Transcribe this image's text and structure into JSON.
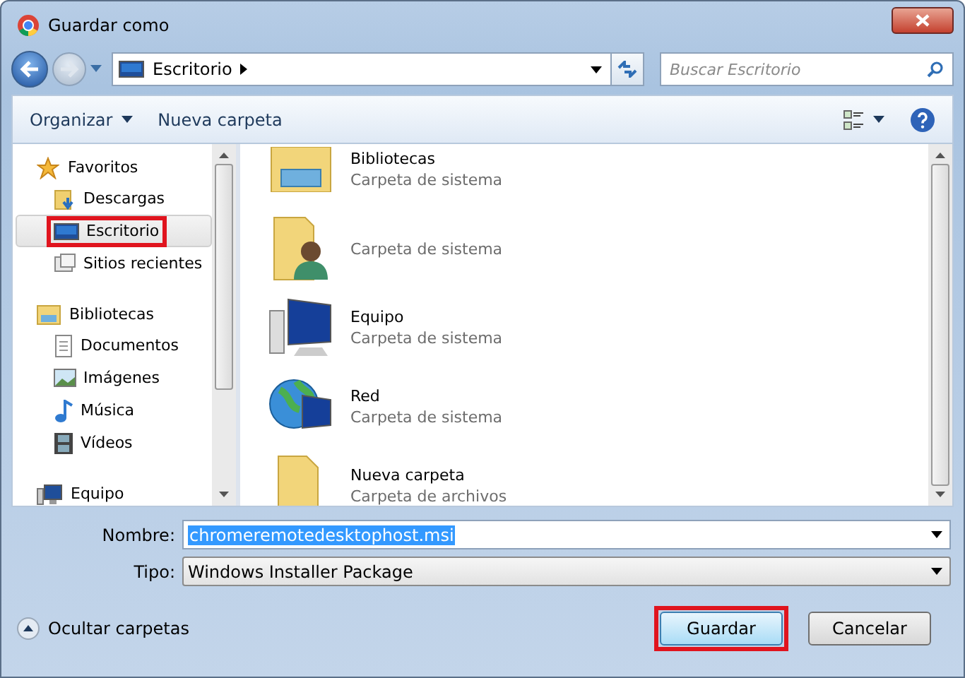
{
  "window": {
    "title": "Guardar como"
  },
  "address": {
    "location": "Escritorio",
    "search_placeholder": "Buscar Escritorio"
  },
  "toolbar": {
    "organize": "Organizar",
    "new_folder": "Nueva carpeta"
  },
  "sidebar": {
    "groups": [
      {
        "label": "Favoritos",
        "kind": "star",
        "children": [
          {
            "label": "Descargas",
            "kind": "downloads",
            "selected": false,
            "highlighted": false
          },
          {
            "label": "Escritorio",
            "kind": "desktop",
            "selected": true,
            "highlighted": true
          },
          {
            "label": "Sitios recientes",
            "kind": "recent",
            "selected": false,
            "highlighted": false
          }
        ]
      },
      {
        "label": "Bibliotecas",
        "kind": "library",
        "children": [
          {
            "label": "Documentos",
            "kind": "document",
            "selected": false,
            "highlighted": false
          },
          {
            "label": "Imágenes",
            "kind": "picture",
            "selected": false,
            "highlighted": false
          },
          {
            "label": "Música",
            "kind": "music",
            "selected": false,
            "highlighted": false
          },
          {
            "label": "Vídeos",
            "kind": "video",
            "selected": false,
            "highlighted": false
          }
        ]
      },
      {
        "label": "Equipo",
        "kind": "computer"
      }
    ]
  },
  "files": [
    {
      "name": "Bibliotecas",
      "type": "Carpeta de sistema",
      "kind": "library"
    },
    {
      "type": "Carpeta de sistema",
      "kind": "user"
    },
    {
      "name": "Equipo",
      "type": "Carpeta de sistema",
      "kind": "computer"
    },
    {
      "name": "Red",
      "type": "Carpeta de sistema",
      "kind": "network"
    },
    {
      "name": "Nueva carpeta",
      "type": "Carpeta de archivos",
      "kind": "folder"
    }
  ],
  "form": {
    "name_label": "Nombre:",
    "name_value": "chromeremotedesktophost.msi",
    "type_label": "Tipo:",
    "type_value": "Windows Installer Package"
  },
  "footer": {
    "hide_folders": "Ocultar carpetas",
    "buttons": [
      {
        "label": "Guardar",
        "highlighted": true
      },
      {
        "label": "Cancelar",
        "highlighted": false
      }
    ]
  }
}
